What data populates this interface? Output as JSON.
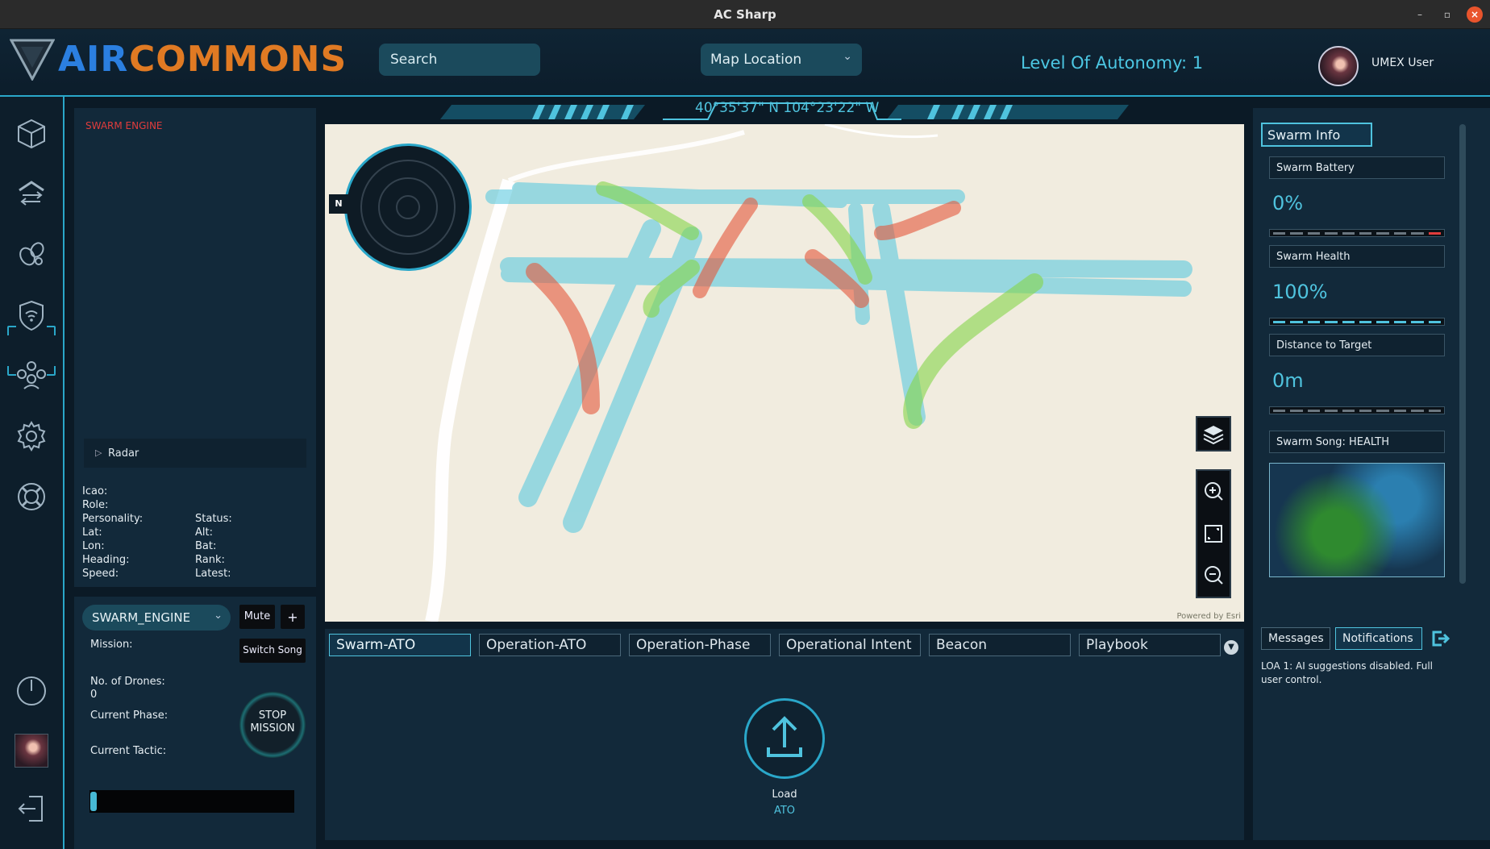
{
  "window": {
    "title": "AC Sharp"
  },
  "header": {
    "logo_air": "AIR",
    "logo_commons": "COMMONS",
    "search_placeholder": "Search",
    "map_location": "Map Location",
    "level_of_autonomy": "Level Of Autonomy: 1",
    "username": "UMEX User"
  },
  "coords": "40°35'37\" N  104°23'22\" W",
  "swarm_panel": {
    "title": "SWARM ENGINE",
    "radar_label": "Radar",
    "fields_left": [
      "Icao:",
      "Role:",
      "Personality:",
      "Lat:",
      "Lon:",
      "Heading:",
      "Speed:"
    ],
    "fields_right": [
      "Status:",
      "Alt:",
      "Bat:",
      "Rank:",
      "Latest:"
    ]
  },
  "swarm_control": {
    "engine": "SWARM_ENGINE",
    "mute": "Mute",
    "add": "+",
    "switch_song": "Switch Song",
    "mission_label": "Mission:",
    "drones_label": "No. of Drones:",
    "drones_value": "0",
    "phase_label": "Current Phase:",
    "tactic_label": "Current Tactic:",
    "stop_line1": "STOP",
    "stop_line2": "MISSION"
  },
  "map": {
    "compass_n": "N",
    "powered_by": "Powered by Esri"
  },
  "tabs": [
    "Swarm-ATO",
    "Operation-ATO",
    "Operation-Phase",
    "Operational Intent",
    "Beacon",
    "Playbook"
  ],
  "active_tab": "Swarm-ATO",
  "upload": {
    "load": "Load",
    "ato": "ATO"
  },
  "swarm_info": {
    "tab": "Swarm Info",
    "battery_label": "Swarm Battery",
    "battery_value": "0%",
    "battery_level": 0,
    "health_label": "Swarm Health",
    "health_value": "100%",
    "health_level": 1,
    "distance_label": "Distance to Target",
    "distance_value": "0m",
    "song_label": "Swarm Song: HEALTH",
    "messages_tab": "Messages",
    "notifications_tab": "Notifications",
    "notice": "LOA 1: AI suggestions disabled. Full user control."
  },
  "colors": {
    "accent": "#2aa7c9",
    "brand_blue": "#2b7fe0",
    "brand_orange": "#e07a23",
    "alert_red": "#e03c3c"
  }
}
